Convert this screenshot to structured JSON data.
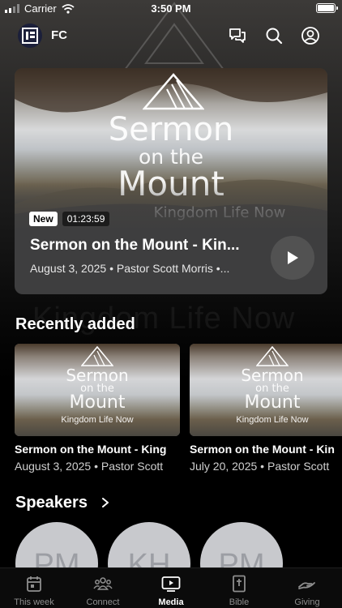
{
  "status_bar": {
    "carrier": "Carrier",
    "time": "3:50 PM"
  },
  "header": {
    "app_name": "FC"
  },
  "hero": {
    "art_title_line1": "Sermon",
    "art_title_line2": "on the",
    "art_title_line3": "Mount",
    "art_subtitle": "Kingdom Life Now",
    "badge": "New",
    "duration": "01:23:59",
    "title": "Sermon on the Mount - Kin...",
    "subtitle": "August 3, 2025 • Pastor Scott Morris •..."
  },
  "recently_added": {
    "heading": "Recently added",
    "items": [
      {
        "art_title_line1": "Sermon",
        "art_title_line2": "on the",
        "art_title_line3": "Mount",
        "art_subtitle": "Kingdom Life Now",
        "title": "Sermon on the Mount - King",
        "date": "August 3, 2025",
        "speaker": "Pastor Scott"
      },
      {
        "art_title_line1": "Sermon",
        "art_title_line2": "on the",
        "art_title_line3": "Mount",
        "art_subtitle": "Kingdom Life Now",
        "title": "Sermon on the Mount - Kin",
        "date": "July 20, 2025",
        "speaker": "Pastor Scott"
      }
    ]
  },
  "speakers": {
    "heading": "Speakers",
    "items": [
      {
        "initials": "PM"
      },
      {
        "initials": "KH"
      },
      {
        "initials": "PM"
      }
    ]
  },
  "tab_bar": {
    "tabs": [
      {
        "label": "This week",
        "icon": "calendar-icon"
      },
      {
        "label": "Connect",
        "icon": "people-icon"
      },
      {
        "label": "Media",
        "icon": "play-screen-icon",
        "active": true
      },
      {
        "label": "Bible",
        "icon": "bible-icon"
      },
      {
        "label": "Giving",
        "icon": "giving-hand-icon"
      }
    ]
  },
  "colors": {
    "background": "#000000",
    "card": "#3e3e3f",
    "speaker_avatar": "#c8c9cd"
  }
}
